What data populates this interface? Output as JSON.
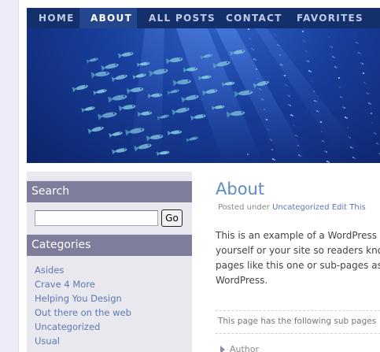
{
  "nav": {
    "items": [
      {
        "label": "HOME",
        "active": false
      },
      {
        "label": "ABOUT",
        "active": true
      },
      {
        "label": "ALL POSTS",
        "active": false
      },
      {
        "label": "CONTACT",
        "active": false
      },
      {
        "label": "FAVORITES",
        "active": false
      }
    ]
  },
  "banner": {
    "image": "underwater-fish-school"
  },
  "sidebar": {
    "search": {
      "heading": "Search",
      "input_value": "",
      "button_label": "Go"
    },
    "categories": {
      "heading": "Categories",
      "items": [
        "Asides",
        "Crave 4 More",
        "Helping You Design",
        "Out there on the web",
        "Uncategorized",
        "Usual"
      ]
    }
  },
  "post": {
    "title": "About",
    "meta_prefix": "Posted under",
    "meta_category": "Uncategorized",
    "meta_edit": "Edit This",
    "body_lines": [
      "This is an example of a WordPress p",
      "yourself or your site so readers know",
      "pages like this one or sub-pages as",
      "WordPress."
    ],
    "subpages_text": "This page has the following sub pages",
    "author_label": "Author"
  },
  "colors": {
    "nav_bg": "#13306d",
    "nav_active": "#24468c",
    "sidebar_heading": "#7e7e9c",
    "link": "#5b79b4",
    "title": "#5b8dc2"
  }
}
